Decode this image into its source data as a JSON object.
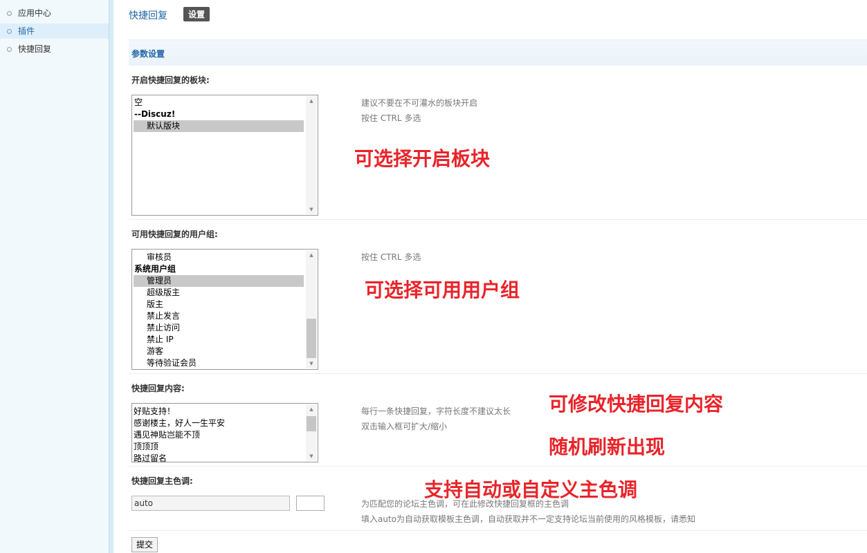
{
  "sidebar": {
    "items": [
      {
        "label": "应用中心"
      },
      {
        "label": "插件"
      },
      {
        "label": "快捷回复"
      }
    ]
  },
  "tabs": {
    "plugin_label": "快捷回复",
    "settings_label": "设置"
  },
  "section_title": "参数设置",
  "forums": {
    "label": "开启快捷回复的板块:",
    "options": [
      "空",
      "--Discuz!",
      "默认版块"
    ],
    "selected": "默认版块",
    "hints": [
      "建议不要在不可灌水的板块开启",
      "按住 CTRL 多选"
    ],
    "annotation": "可选择开启板块"
  },
  "groups": {
    "label": "可用快捷回复的用户组:",
    "options": [
      "审核员",
      "系统用户组",
      "管理员",
      "超级版主",
      "版主",
      "禁止发言",
      "禁止访问",
      "禁止 IP",
      "游客",
      "等待验证会员"
    ],
    "selected": "管理员",
    "hints": [
      "按住 CTRL 多选"
    ],
    "annotation": "可选择可用用户组"
  },
  "replies": {
    "label": "快捷回复内容:",
    "lines": [
      "好贴支持！",
      "感谢楼主，好人一生平安",
      "遇见神贴岂能不顶",
      "顶顶顶",
      "路过留名"
    ],
    "hints": [
      "每行一条快捷回复，字符长度不建议太长",
      "双击输入框可扩大/缩小"
    ],
    "annotations": [
      "可修改快捷回复内容",
      "随机刷新出现"
    ]
  },
  "color": {
    "label": "快捷回复主色调:",
    "value": "auto",
    "hints": [
      "为匹配您的论坛主色调，可在此修改快捷回复框的主色调",
      "填入auto为自动获取模板主色调，自动获取并不一定支持论坛当前使用的风格模板，请悉知"
    ],
    "annotation": "支持自动或自定义主色调"
  },
  "submit_label": "提交"
}
